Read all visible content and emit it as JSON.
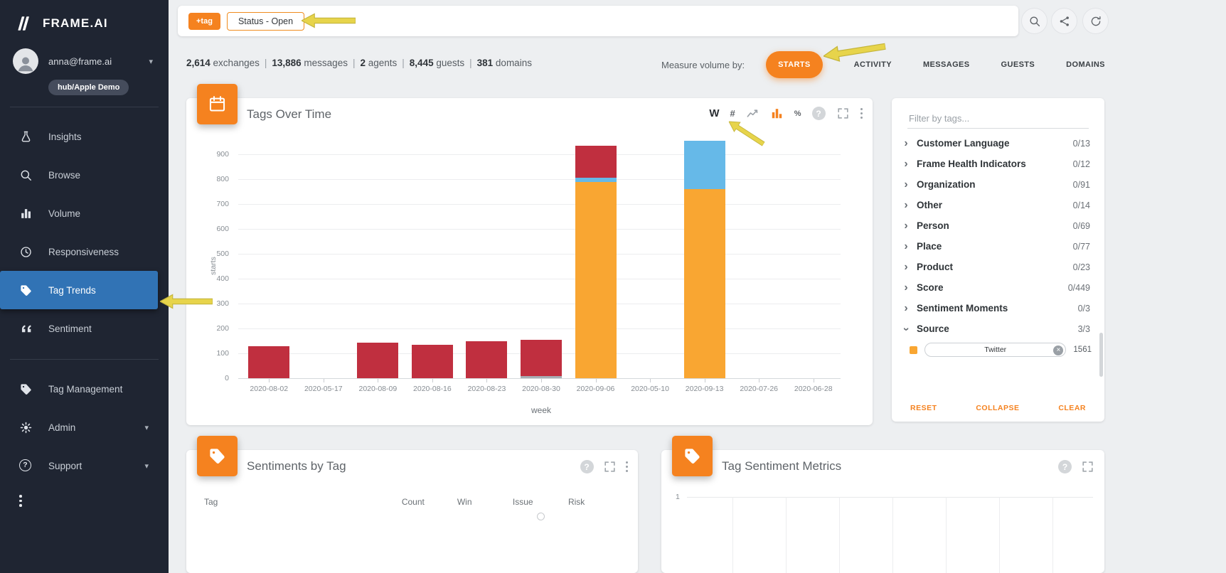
{
  "colors": {
    "accent_orange": "#f5821f",
    "active_nav_blue": "#3173b5",
    "annotation_yellow": "#e7d44b",
    "sidebar_bg": "#1f2532"
  },
  "sidebar": {
    "logo_text": "FRAME.AI",
    "user_email": "anna@frame.ai",
    "workspace_badge": "hub/Apple Demo",
    "nav": [
      {
        "id": "insights",
        "label": "Insights",
        "icon": "flask"
      },
      {
        "id": "browse",
        "label": "Browse",
        "icon": "search"
      },
      {
        "id": "volume",
        "label": "Volume",
        "icon": "bars"
      },
      {
        "id": "responsiveness",
        "label": "Responsiveness",
        "icon": "history"
      },
      {
        "id": "tag-trends",
        "label": "Tag Trends",
        "icon": "tag",
        "active": true
      },
      {
        "id": "sentiment",
        "label": "Sentiment",
        "icon": "quote"
      }
    ],
    "nav_secondary": [
      {
        "id": "tag-management",
        "label": "Tag Management",
        "icon": "tag"
      },
      {
        "id": "admin",
        "label": "Admin",
        "icon": "gear",
        "caret": true
      },
      {
        "id": "support",
        "label": "Support",
        "icon": "help",
        "caret": true
      }
    ]
  },
  "topbar": {
    "add_tag_button": "+tag",
    "filter_chip": "Status - Open"
  },
  "stats": [
    {
      "value": "2,614",
      "label": "exchanges"
    },
    {
      "value": "13,886",
      "label": "messages"
    },
    {
      "value": "2",
      "label": "agents"
    },
    {
      "value": "8,445",
      "label": "guests"
    },
    {
      "value": "381",
      "label": "domains"
    }
  ],
  "measure": {
    "label": "Measure volume by:",
    "selected": "STARTS",
    "options": [
      "STARTS",
      "ACTIVITY",
      "MESSAGES",
      "GUESTS",
      "DOMAINS"
    ]
  },
  "tags_over_time": {
    "title": "Tags Over Time",
    "controls": {
      "weekly": "W",
      "count": "#",
      "percent": "%"
    }
  },
  "chart_data": {
    "type": "bar",
    "stacked": true,
    "title": "Tags Over Time",
    "xlabel": "week",
    "ylabel": "starts",
    "ylim": [
      0,
      960
    ],
    "yticks": [
      0,
      100,
      200,
      300,
      400,
      500,
      600,
      700,
      800,
      900
    ],
    "grid": true,
    "legend": false,
    "categories": [
      "2020-08-02",
      "2020-05-17",
      "2020-08-09",
      "2020-08-16",
      "2020-08-23",
      "2020-08-30",
      "2020-09-06",
      "2020-05-10",
      "2020-09-13",
      "2020-07-26",
      "2020-06-28"
    ],
    "series": [
      {
        "name": "amber",
        "color": "#f9a632",
        "values": [
          0,
          0,
          0,
          0,
          0,
          0,
          790,
          0,
          760,
          0,
          0
        ]
      },
      {
        "name": "gray",
        "color": "#a7adb3",
        "values": [
          0,
          0,
          0,
          0,
          0,
          8,
          0,
          0,
          0,
          0,
          0
        ]
      },
      {
        "name": "blue",
        "color": "#66b9e8",
        "values": [
          0,
          0,
          0,
          0,
          0,
          0,
          15,
          0,
          195,
          0,
          0
        ]
      },
      {
        "name": "red",
        "color": "#c02f3f",
        "values": [
          130,
          0,
          142,
          133,
          150,
          145,
          128,
          0,
          0,
          0,
          0
        ]
      }
    ]
  },
  "filter_panel": {
    "placeholder": "Filter by tags...",
    "groups": [
      {
        "label": "Customer Language",
        "count": "0/13"
      },
      {
        "label": "Frame Health Indicators",
        "count": "0/12"
      },
      {
        "label": "Organization",
        "count": "0/91"
      },
      {
        "label": "Other",
        "count": "0/14"
      },
      {
        "label": "Person",
        "count": "0/69"
      },
      {
        "label": "Place",
        "count": "0/77"
      },
      {
        "label": "Product",
        "count": "0/23"
      },
      {
        "label": "Score",
        "count": "0/449"
      },
      {
        "label": "Sentiment Moments",
        "count": "0/3"
      },
      {
        "label": "Source",
        "count": "3/3",
        "expanded": true,
        "children": [
          {
            "label": "Twitter",
            "count": "1561",
            "color": "#f9a632"
          }
        ]
      }
    ],
    "footer": {
      "reset": "RESET",
      "collapse": "COLLAPSE",
      "clear": "CLEAR"
    }
  },
  "sentiments_by_tag": {
    "title": "Sentiments by Tag",
    "columns": [
      "Tag",
      "Count",
      "Win",
      "Issue",
      "Risk"
    ]
  },
  "tag_sentiment_metrics": {
    "title": "Tag Sentiment Metrics",
    "y_tick": "1"
  }
}
